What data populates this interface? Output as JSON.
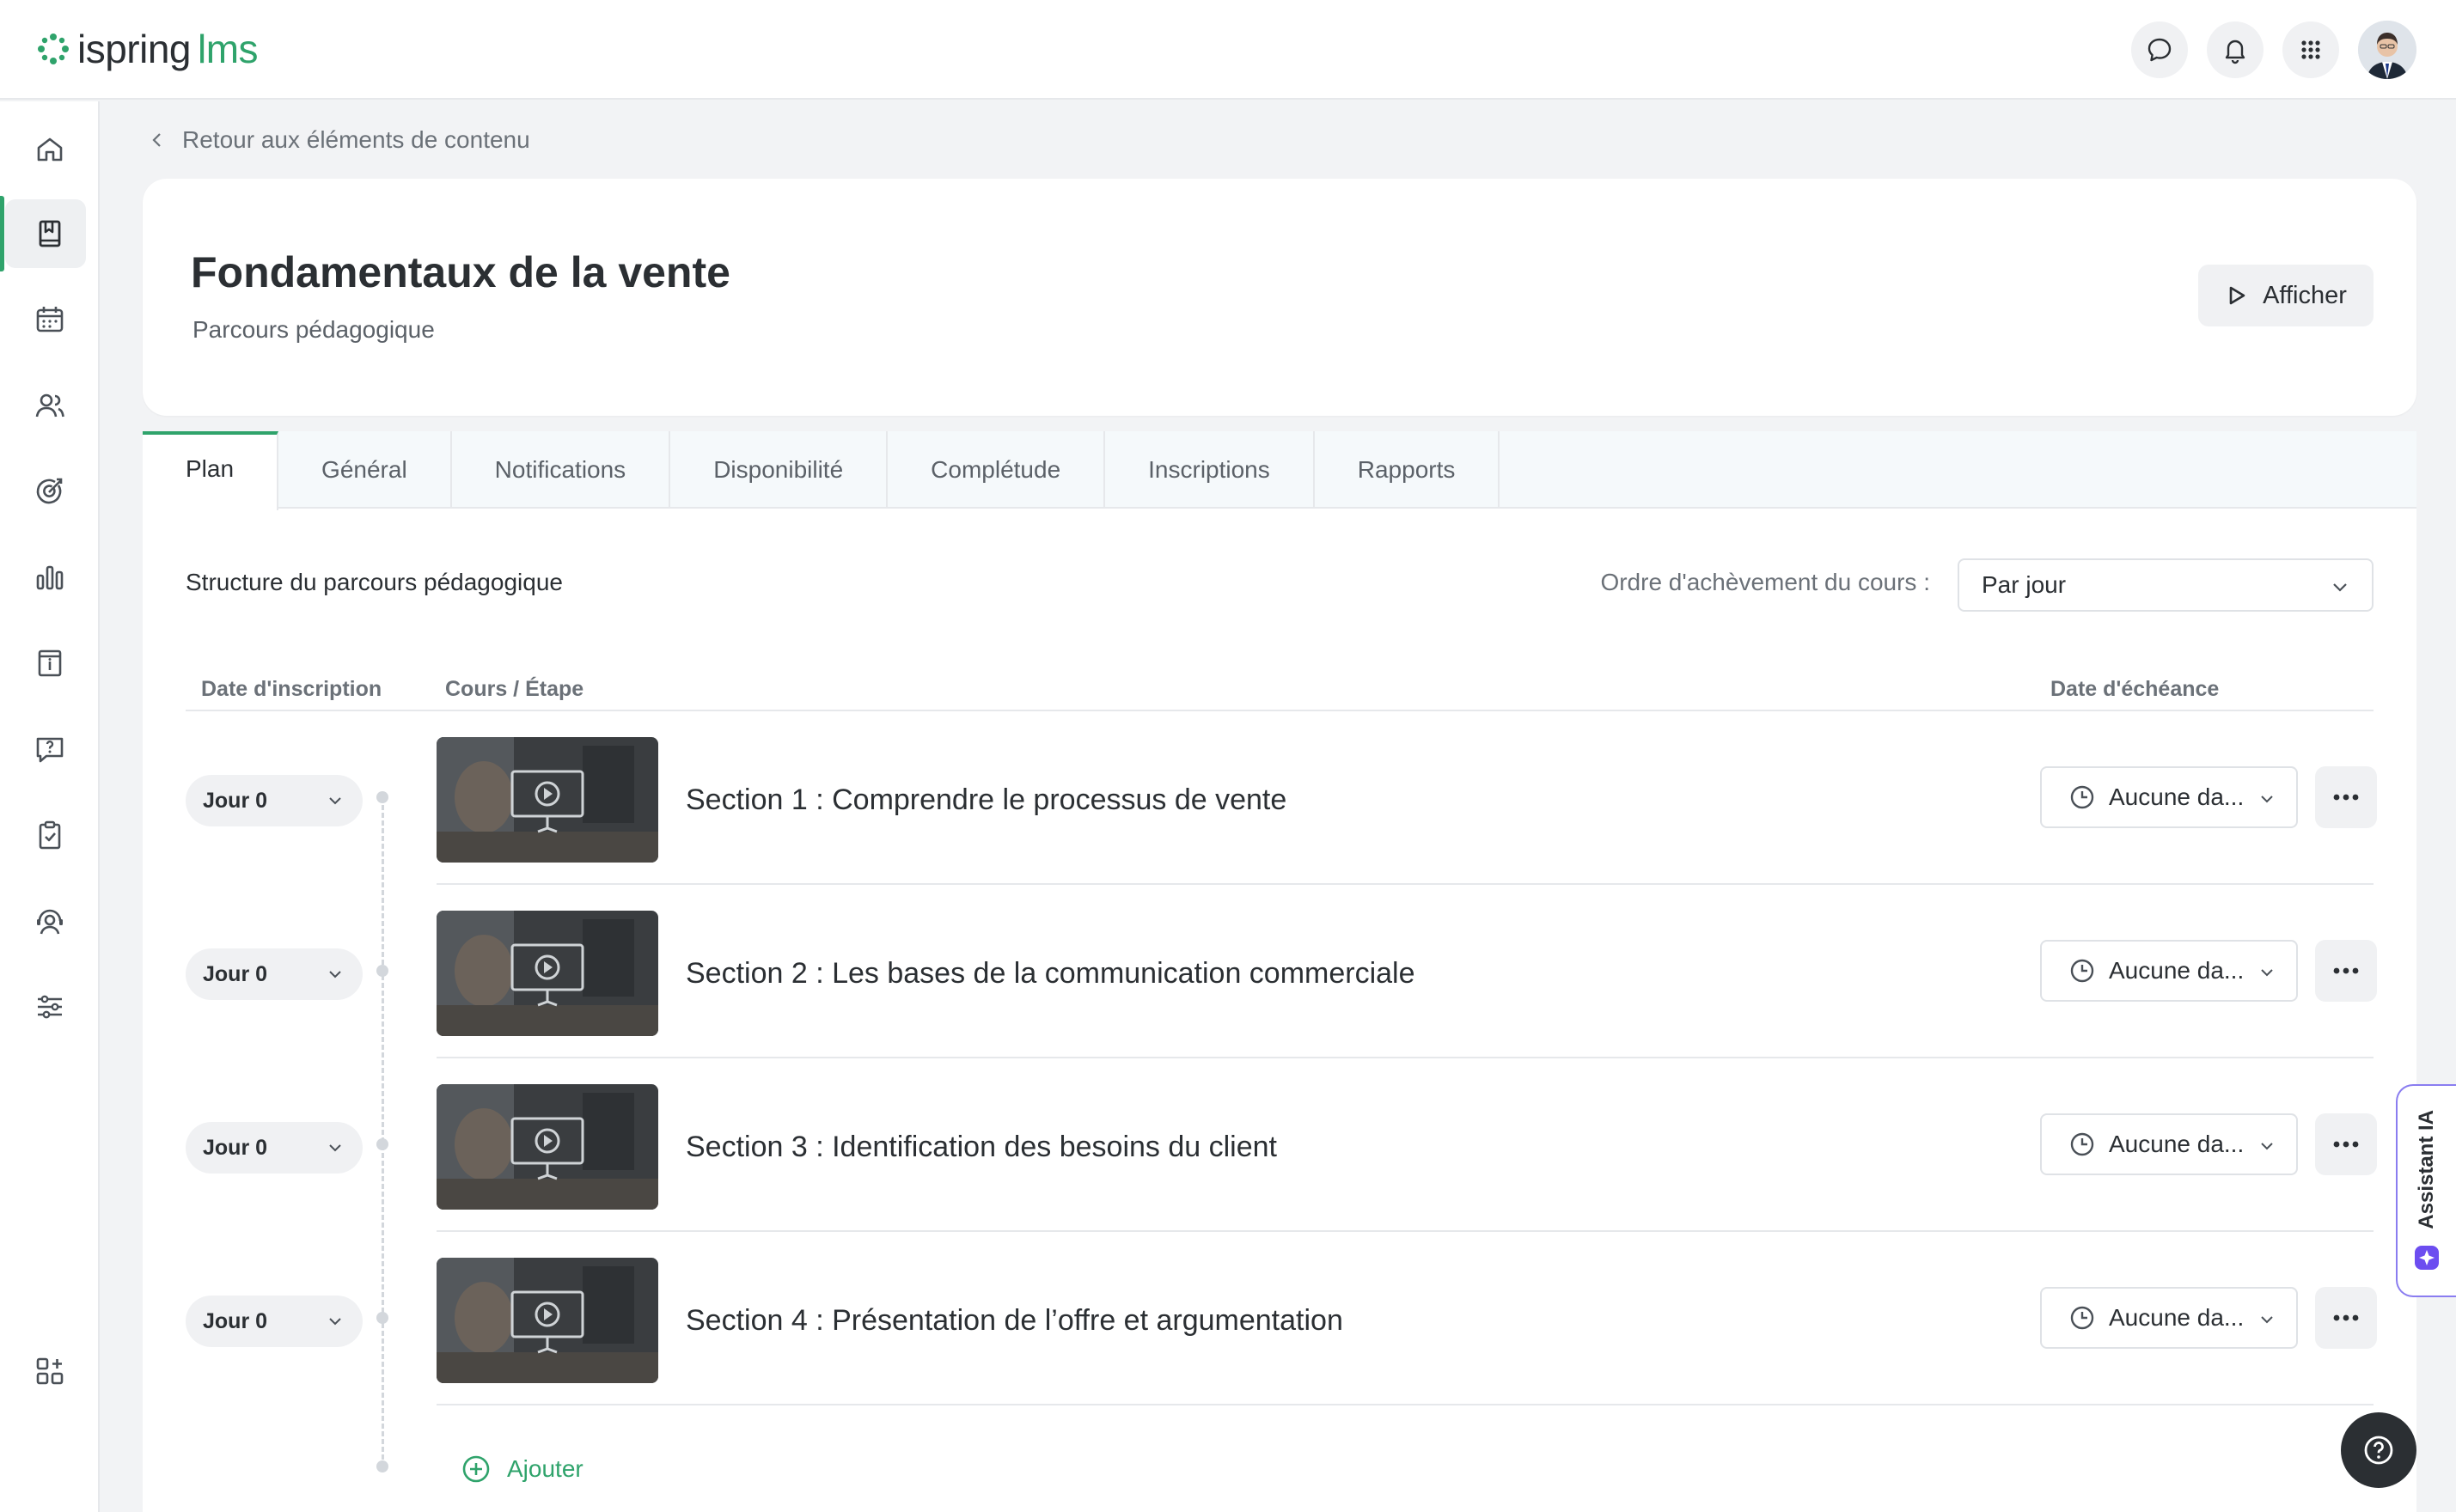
{
  "app": {
    "logo_word": "ispring",
    "logo_suffix": "lms",
    "brand_color": "#2fa36b"
  },
  "topbar": {
    "icons": [
      "chat-icon",
      "bell-icon",
      "apps-grid-icon"
    ],
    "avatar": "user-avatar"
  },
  "sidebar": {
    "items": [
      {
        "name": "home-icon",
        "active": false
      },
      {
        "name": "content-library-icon",
        "active": true
      },
      {
        "name": "calendar-icon",
        "active": false
      },
      {
        "name": "users-icon",
        "active": false
      },
      {
        "name": "goals-icon",
        "active": false
      },
      {
        "name": "reports-chart-icon",
        "active": false
      },
      {
        "name": "info-board-icon",
        "active": false
      },
      {
        "name": "questions-icon",
        "active": false
      },
      {
        "name": "tasks-clipboard-icon",
        "active": false
      },
      {
        "name": "support-agent-icon",
        "active": false
      },
      {
        "name": "settings-sliders-icon",
        "active": false
      },
      {
        "name": "add-widget-icon",
        "active": false
      }
    ]
  },
  "breadcrumb": {
    "back_label": "Retour aux éléments de contenu"
  },
  "header": {
    "title": "Fondamentaux de la vente",
    "subtitle": "Parcours pédagogique",
    "view_button": "Afficher"
  },
  "tabs": [
    {
      "label": "Plan",
      "active": true
    },
    {
      "label": "Général",
      "active": false
    },
    {
      "label": "Notifications",
      "active": false
    },
    {
      "label": "Disponibilité",
      "active": false
    },
    {
      "label": "Complétude",
      "active": false
    },
    {
      "label": "Inscriptions",
      "active": false
    },
    {
      "label": "Rapports",
      "active": false
    }
  ],
  "plan": {
    "structure_label": "Structure du parcours pédagogique",
    "order_label": "Ordre d'achèvement du cours :",
    "order_value": "Par jour",
    "columns": {
      "enroll_date": "Date d'inscription",
      "course_step": "Cours / Étape",
      "due_date": "Date d'échéance"
    },
    "rows": [
      {
        "day": "Jour 0",
        "title": "Section 1 : Comprendre le processus de vente",
        "due": "Aucune da..."
      },
      {
        "day": "Jour 0",
        "title": "Section 2 : Les bases de la communication commerciale",
        "due": "Aucune da..."
      },
      {
        "day": "Jour 0",
        "title": "Section 3 : Identification des besoins du client",
        "due": "Aucune da..."
      },
      {
        "day": "Jour 0",
        "title": "Section 4 : Présentation de l’offre et argumentation",
        "due": "Aucune da..."
      }
    ],
    "add_label": "Ajouter"
  },
  "assistant": {
    "label": "Assistant IA"
  }
}
